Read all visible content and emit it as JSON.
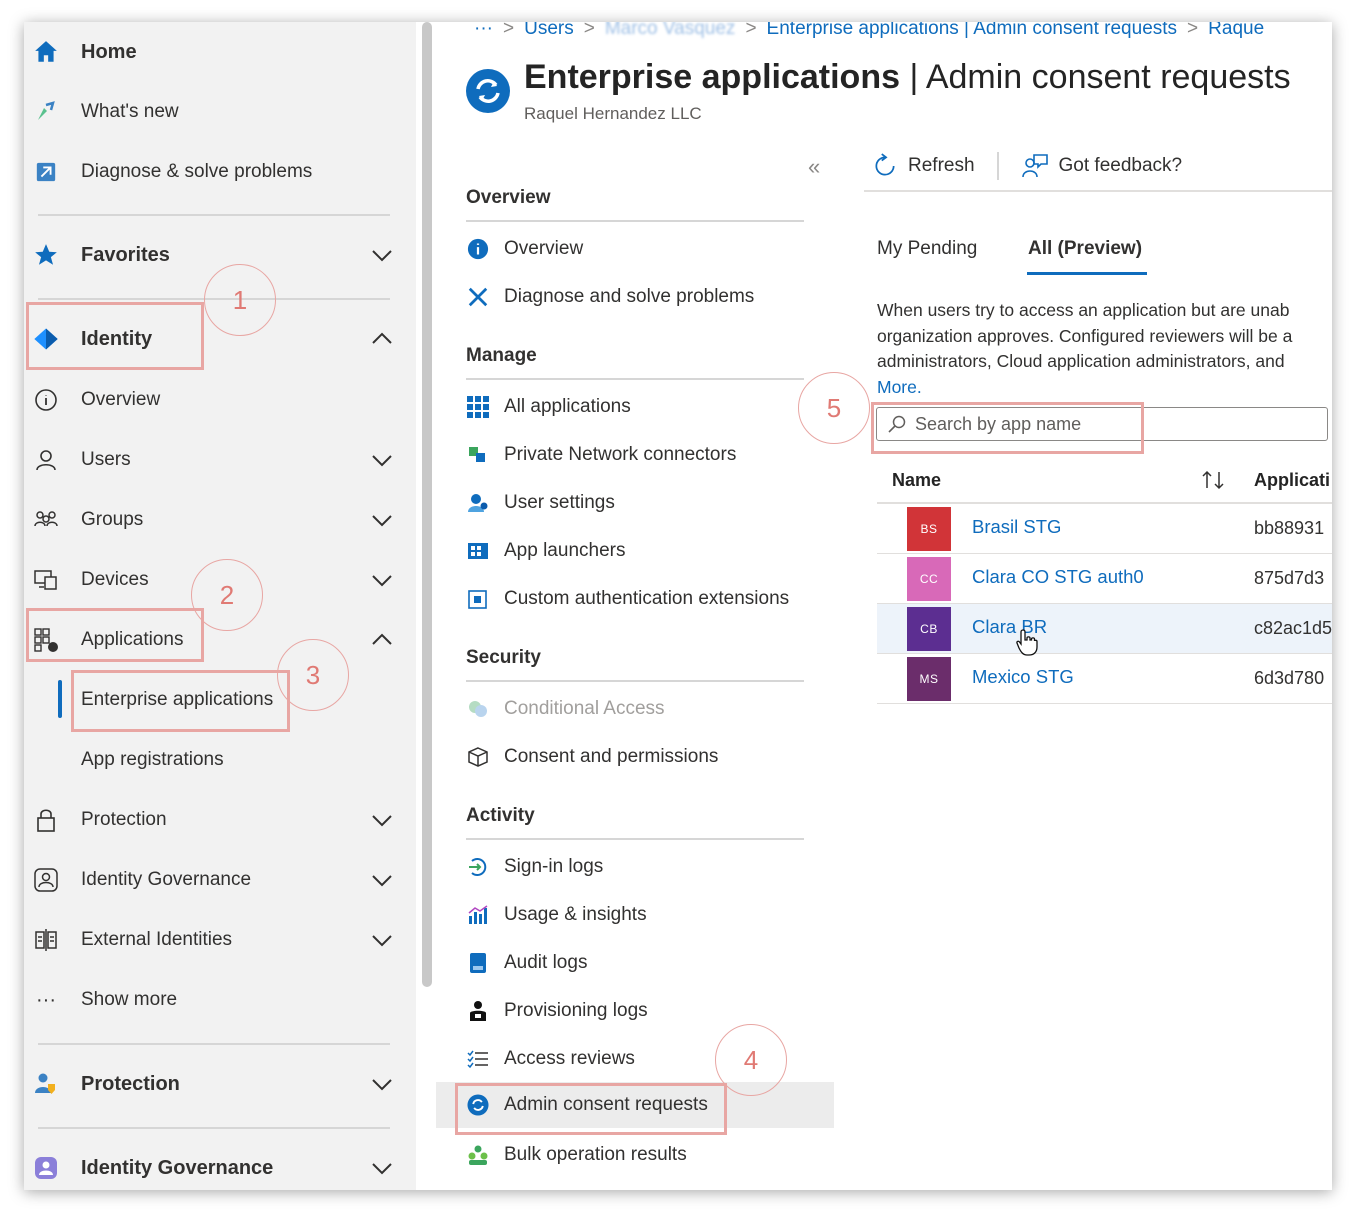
{
  "breadcrumb": {
    "ellipsis": "···",
    "items": [
      "Users",
      "Marco Vasquez",
      "Enterprise applications | Admin consent requests",
      "Raque"
    ]
  },
  "header": {
    "title_bold": "Enterprise applications",
    "title_rest": " | Admin consent requests",
    "subtitle": "Raquel Hernandez LLC"
  },
  "leftnav": {
    "home": "Home",
    "whats_new": "What's new",
    "diagnose": "Diagnose & solve problems",
    "favorites": "Favorites",
    "identity": "Identity",
    "overview": "Overview",
    "users": "Users",
    "groups": "Groups",
    "devices": "Devices",
    "applications": "Applications",
    "enterprise_applications": "Enterprise applications",
    "app_registrations": "App registrations",
    "protection": "Protection",
    "identity_governance": "Identity Governance",
    "external_identities": "External Identities",
    "show_more": "Show more",
    "protection_section": "Protection",
    "identity_governance_section": "Identity Governance"
  },
  "menu": {
    "collapse": "«",
    "sections": {
      "overview": "Overview",
      "manage": "Manage",
      "security": "Security",
      "activity": "Activity"
    },
    "items": {
      "overview": "Overview",
      "diagnose": "Diagnose and solve problems",
      "all_applications": "All applications",
      "private_network": "Private Network connectors",
      "user_settings": "User settings",
      "app_launchers": "App launchers",
      "custom_auth": "Custom authentication extensions",
      "conditional_access": "Conditional Access",
      "consent_permissions": "Consent and permissions",
      "signin_logs": "Sign-in logs",
      "usage_insights": "Usage & insights",
      "audit_logs": "Audit logs",
      "provisioning_logs": "Provisioning logs",
      "access_reviews": "Access reviews",
      "admin_consent": "Admin consent requests",
      "bulk_operation": "Bulk operation results"
    }
  },
  "toolbar": {
    "refresh": "Refresh",
    "feedback": "Got feedback?"
  },
  "tabs": {
    "my_pending": "My Pending",
    "all_preview": "All (Preview)"
  },
  "description": {
    "line1": "When users try to access an application but are unab",
    "line2": "organization approves. Configured reviewers will be a",
    "line3": "administrators, Cloud application administrators, and",
    "more": "More."
  },
  "search": {
    "placeholder": "Search by app name"
  },
  "table": {
    "columns": [
      "Name",
      "Applicati"
    ],
    "rows": [
      {
        "initials": "BS",
        "name": "Brasil STG",
        "app_id": "bb88931",
        "color": "#d13438"
      },
      {
        "initials": "CC",
        "name": "Clara CO STG auth0",
        "app_id": "875d7d3",
        "color": "#d869b8"
      },
      {
        "initials": "CB",
        "name": "Clara BR",
        "app_id": "c82ac1d5",
        "color": "#5c2e91"
      },
      {
        "initials": "MS",
        "name": "Mexico STG",
        "app_id": "6d3d780",
        "color": "#6b2d6b"
      }
    ]
  },
  "annotations": [
    "1",
    "2",
    "3",
    "4",
    "5"
  ],
  "colors": {
    "accent": "#0f6cbd",
    "highlight": "#e8a6a3"
  }
}
